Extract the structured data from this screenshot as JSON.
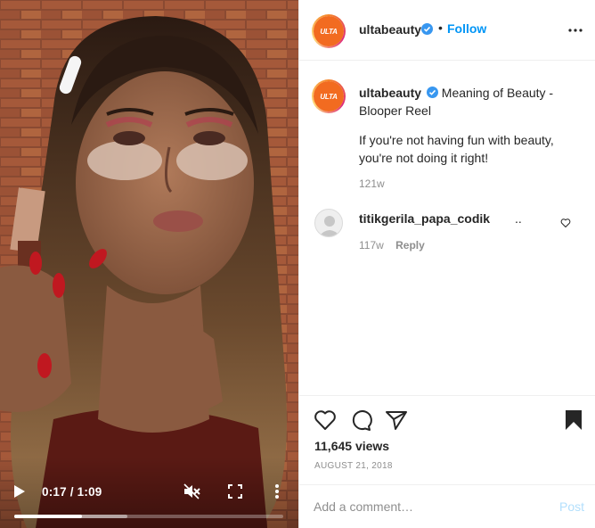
{
  "video": {
    "time": "0:17 / 1:09",
    "progress_played": 0.25,
    "progress_buffered": 0.42
  },
  "header": {
    "username": "ultabeauty",
    "separator": "•",
    "follow_label": "Follow",
    "avatar_text": "ULTA"
  },
  "caption": {
    "username": "ultabeauty",
    "title": "Meaning of Beauty - Blooper Reel",
    "body": "If you're not having fun with beauty, you're not doing it right!",
    "time": "121w"
  },
  "comment": {
    "username": "titikgerila_papa_codik",
    "text": "..",
    "time": "117w",
    "reply_label": "Reply"
  },
  "actions": {
    "views": "11,645 views",
    "date": "AUGUST 21, 2018"
  },
  "add_comment": {
    "placeholder": "Add a comment…",
    "post_label": "Post"
  },
  "colors": {
    "accent": "#0095f6",
    "post_disabled": "#b2dffc",
    "brand_orange": "#f26b20"
  }
}
